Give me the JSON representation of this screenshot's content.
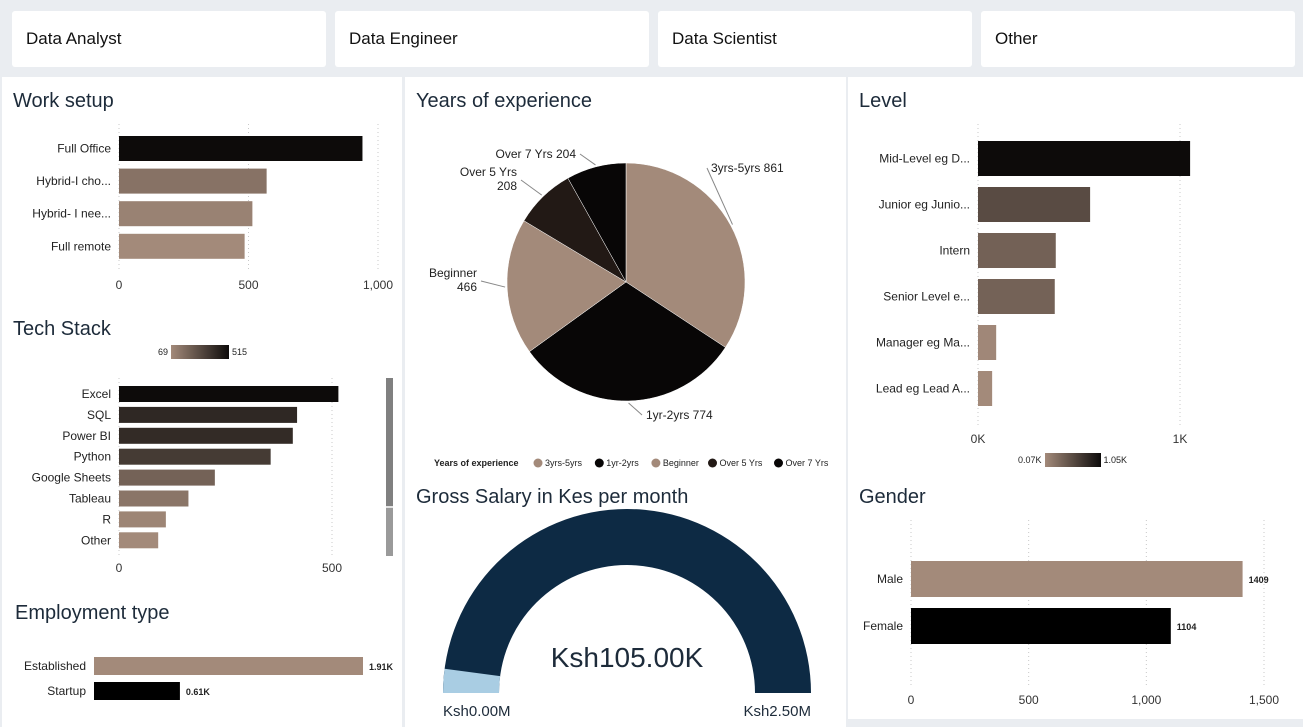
{
  "filters": [
    "Data Analyst",
    "Data Engineer",
    "Data Scientist",
    "Other"
  ],
  "colors": {
    "lightest": "#a38a7a",
    "darkest": "#0d0b0a",
    "navy": "#0d2a44",
    "gauge_fill": "#a9cde3"
  },
  "work_setup": {
    "title": "Work setup",
    "chart_data": {
      "type": "bar",
      "orientation": "horizontal",
      "categories": [
        "Full Office",
        "Hybrid-I cho...",
        "Hybrid- I nee...",
        "Full remote"
      ],
      "values": [
        940,
        570,
        515,
        485
      ],
      "xlim": [
        0,
        1000
      ],
      "ticks": [
        0,
        500,
        1000
      ],
      "tick_labels": [
        "0",
        "500",
        "1,000"
      ]
    }
  },
  "tech_stack": {
    "title": "Tech Stack",
    "legend": {
      "min_label": "69",
      "max_label": "515"
    },
    "chart_data": {
      "type": "bar",
      "orientation": "horizontal",
      "categories": [
        "Excel",
        "SQL",
        "Power BI",
        "Python",
        "Google Sheets",
        "Tableau",
        "R",
        "Other"
      ],
      "values": [
        515,
        418,
        408,
        356,
        225,
        163,
        110,
        92
      ],
      "xlim": [
        0,
        500
      ],
      "ticks": [
        0,
        500
      ],
      "tick_labels": [
        "0",
        "500"
      ]
    }
  },
  "employment_type": {
    "title": "Employment type",
    "chart_data": {
      "type": "bar",
      "orientation": "horizontal",
      "categories": [
        "Established",
        "Startup"
      ],
      "values": [
        1910,
        610
      ],
      "data_labels": [
        "1.91K",
        "0.61K"
      ],
      "xlim": [
        0,
        1910
      ]
    }
  },
  "years_experience": {
    "title": "Years of experience",
    "legend_title": "Years of experience",
    "chart_data": {
      "type": "pie",
      "slices": [
        {
          "label": "3yrs-5yrs",
          "value": 861,
          "data_label": "3yrs-5yrs 861",
          "color": "#a38a7a"
        },
        {
          "label": "1yr-2yrs",
          "value": 774,
          "data_label": "1yr-2yrs 774",
          "color": "#080606"
        },
        {
          "label": "Beginner",
          "value": 466,
          "data_label": "Beginner 466",
          "color": "#a38a7a"
        },
        {
          "label": "Over 5 Yrs",
          "value": 208,
          "data_label": "Over 5 Yrs 208",
          "color": "#221915"
        },
        {
          "label": "Over  7 Yrs",
          "value": 204,
          "data_label": "Over 7 Yrs 204",
          "color": "#080606"
        }
      ]
    }
  },
  "level": {
    "title": "Level",
    "legend": {
      "min_label": "0.07K",
      "max_label": "1.05K"
    },
    "chart_data": {
      "type": "bar",
      "orientation": "horizontal",
      "categories": [
        "Mid-Level eg D...",
        "Junior eg Junio...",
        "Intern",
        "Senior Level e...",
        "Manager eg Ma...",
        "Lead eg Lead A..."
      ],
      "values": [
        1050,
        555,
        385,
        380,
        90,
        70
      ],
      "xlim": [
        0,
        1000
      ],
      "ticks": [
        0,
        1000
      ],
      "tick_labels": [
        "0K",
        "1K"
      ]
    }
  },
  "gross_salary": {
    "title": "Gross Salary in Kes per month",
    "chart_data": {
      "type": "gauge",
      "value": 105000,
      "min": 0,
      "max": 2500000,
      "value_label": "Ksh105.00K",
      "min_label": "Ksh0.00M",
      "max_label": "Ksh2.50M"
    }
  },
  "gender": {
    "title": "Gender",
    "chart_data": {
      "type": "bar",
      "orientation": "horizontal",
      "categories": [
        "Male",
        "Female"
      ],
      "values": [
        1409,
        1104
      ],
      "data_labels": [
        "1409",
        "1104"
      ],
      "xlim": [
        0,
        1500
      ],
      "ticks": [
        0,
        500,
        1000,
        1500
      ],
      "tick_labels": [
        "0",
        "500",
        "1,000",
        "1,500"
      ]
    }
  }
}
